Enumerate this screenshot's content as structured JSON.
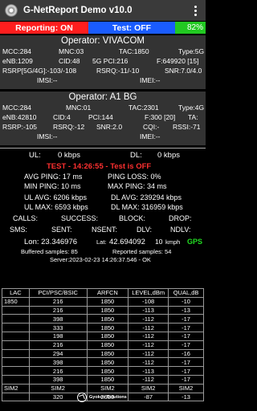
{
  "app": {
    "title": "G-NetReport Demo v10.0"
  },
  "status": {
    "reporting": "Reporting: ON",
    "test": "Test: OFF",
    "battery": "82%"
  },
  "sim1": {
    "operator": "Operator: VIVACOM",
    "rows": [
      [
        "MCC:284",
        "MNC:03",
        "TAC:1850",
        "Type:5G"
      ],
      [
        "eNB:1209",
        "CID:48",
        "5G PCI:216",
        "F:649920 [15]"
      ],
      [
        "RSRP[5G/4G]:-103/-108",
        "RSRQ:-11/-10",
        "SNR:7.0/4.0"
      ],
      [
        "IMSI:--",
        "IMEI:--"
      ]
    ]
  },
  "sim2": {
    "operator": "Operator: A1 BG",
    "rows": [
      [
        "MCC:284",
        "MNC:01",
        "TAC:2301",
        "Type:4G"
      ],
      [
        "eNB:42810",
        "CID:4",
        "PCI:144",
        "F:300 [20]",
        "TA:"
      ],
      [
        "RSRP:-105",
        "RSRQ:-12",
        "SNR:2.0",
        "CQI:-",
        "RSSI:-71"
      ],
      [
        "IMSI:--",
        "IMEI:--"
      ]
    ]
  },
  "test": {
    "ul_label": "UL:",
    "ul_value": "0 kbps",
    "dl_label": "DL:",
    "dl_value": "0 kbps",
    "banner": "TEST - 14:26:55 - Test is OFF",
    "avg_ping": "AVG PING: 17 ms",
    "ping_loss": "PING LOSS: 0%",
    "min_ping": "MIN PING: 10 ms",
    "max_ping": "MAX PING: 34 ms",
    "ul_avg": "UL AVG: 6206 kbps",
    "dl_avg": "DL AVG: 239294 kbps",
    "ul_max": "UL MAX: 6593 kbps",
    "dl_max": "DL MAX: 316959 kbps",
    "calls": "CALLS:",
    "success": "SUCCESS:",
    "block": "BLOCK:",
    "drop": "DROP:",
    "sms": "SMS:",
    "sent": "SENT:",
    "nsent": "NSENT:",
    "dlv": "DLV:",
    "ndlv": "NDLV:"
  },
  "gps": {
    "lon": "Lon: 23.346976",
    "lat_label": "Lat:",
    "lat_value": "42.694092",
    "speed_value": "10",
    "speed_unit": "kmph",
    "gps_label": "GPS",
    "buffered": "Buffered samples: 85",
    "reported": "Reported samples: 54",
    "server": "Server:2023-02-23 14:26:37.546 - OK"
  },
  "table": {
    "headers": [
      "LAC",
      "PCI/PSC/BSIC",
      "ARFCN",
      "LEVEL,dBm",
      "QUAL,dB"
    ],
    "rows": [
      [
        "1850",
        "216",
        "1850",
        "-108",
        "-10"
      ],
      [
        "",
        "216",
        "1850",
        "-113",
        "-13"
      ],
      [
        "",
        "398",
        "1850",
        "-112",
        "-17"
      ],
      [
        "",
        "333",
        "1850",
        "-112",
        "-17"
      ],
      [
        "",
        "198",
        "1850",
        "-112",
        "-17"
      ],
      [
        "",
        "216",
        "1850",
        "-112",
        "-17"
      ],
      [
        "",
        "294",
        "1850",
        "-112",
        "-16"
      ],
      [
        "",
        "398",
        "1850",
        "-112",
        "-17"
      ],
      [
        "",
        "216",
        "1850",
        "-113",
        "-17"
      ],
      [
        "",
        "398",
        "1850",
        "-112",
        "-17"
      ],
      [
        "SIM2",
        "SIM2",
        "SIM2",
        "SIM2",
        "SIM2"
      ],
      [
        "",
        "320",
        "2950",
        "-87",
        "-13"
      ]
    ]
  },
  "footer": {
    "brand": "Gyokov Solutions"
  }
}
